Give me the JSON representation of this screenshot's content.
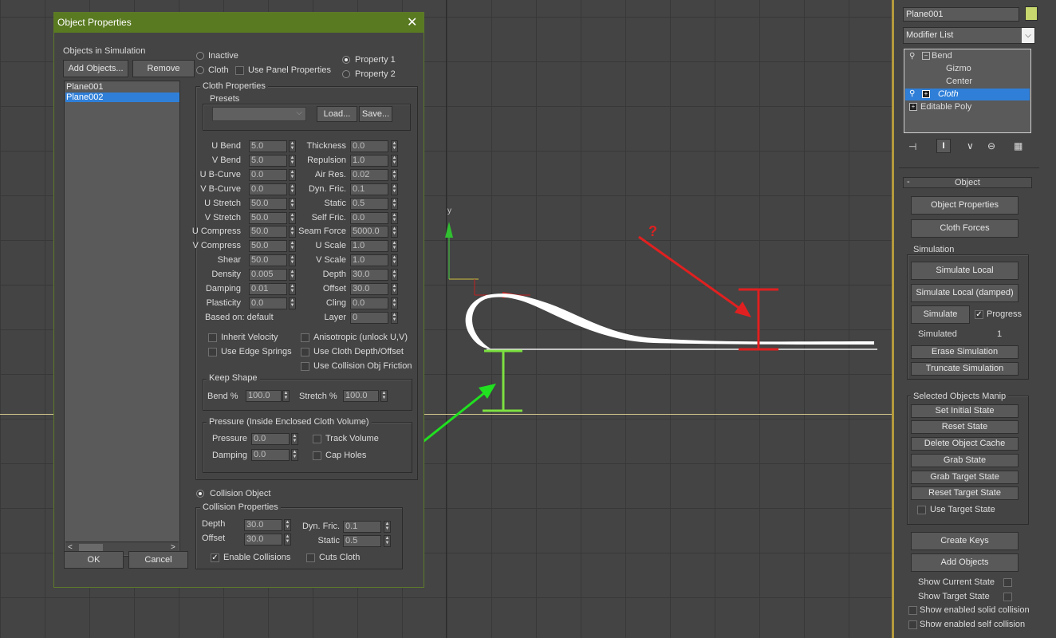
{
  "dialog": {
    "title": "Object Properties",
    "objects_label": "Objects in Simulation",
    "add_objects": "Add Objects...",
    "remove": "Remove",
    "objects": [
      "Plane001",
      "Plane002"
    ],
    "selected_object": "Plane002",
    "ok": "OK",
    "cancel": "Cancel",
    "inactive": "Inactive",
    "cloth": "Cloth",
    "use_panel_properties": "Use Panel Properties",
    "property1": "Property 1",
    "property2": "Property 2",
    "cloth_properties_title": "Cloth Properties",
    "presets_title": "Presets",
    "load": "Load...",
    "save": "Save...",
    "left_params": [
      {
        "label": "U Bend",
        "value": "5.0"
      },
      {
        "label": "V Bend",
        "value": "5.0"
      },
      {
        "label": "U B-Curve",
        "value": "0.0"
      },
      {
        "label": "V B-Curve",
        "value": "0.0"
      },
      {
        "label": "U Stretch",
        "value": "50.0"
      },
      {
        "label": "V Stretch",
        "value": "50.0"
      },
      {
        "label": "U Compress",
        "value": "50.0"
      },
      {
        "label": "V Compress",
        "value": "50.0"
      },
      {
        "label": "Shear",
        "value": "50.0"
      },
      {
        "label": "Density",
        "value": "0.005"
      },
      {
        "label": "Damping",
        "value": "0.01"
      },
      {
        "label": "Plasticity",
        "value": "0.0"
      }
    ],
    "right_params": [
      {
        "label": "Thickness",
        "value": "0.0"
      },
      {
        "label": "Repulsion",
        "value": "1.0"
      },
      {
        "label": "Air Res.",
        "value": "0.02"
      },
      {
        "label": "Dyn. Fric.",
        "value": "0.1"
      },
      {
        "label": "Static",
        "value": "0.5"
      },
      {
        "label": "Self Fric.",
        "value": "0.0"
      },
      {
        "label": "Seam Force",
        "value": "5000.0"
      },
      {
        "label": "U Scale",
        "value": "1.0"
      },
      {
        "label": "V Scale",
        "value": "1.0"
      },
      {
        "label": "Depth",
        "value": "30.0"
      },
      {
        "label": "Offset",
        "value": "30.0"
      },
      {
        "label": "Cling",
        "value": "0.0"
      },
      {
        "label": "Layer",
        "value": "0"
      }
    ],
    "based_on": "Based on: default",
    "inherit_velocity": "Inherit Velocity",
    "use_edge_springs": "Use Edge Springs",
    "anisotropic": "Anisotropic (unlock U,V)",
    "use_cloth_depth": "Use Cloth Depth/Offset",
    "use_collision_friction": "Use Collision Obj Friction",
    "keep_shape_title": "Keep Shape",
    "bend_pct_label": "Bend %",
    "bend_pct": "100.0",
    "stretch_pct_label": "Stretch %",
    "stretch_pct": "100.0",
    "pressure_title": "Pressure (Inside Enclosed Cloth Volume)",
    "pressure_label": "Pressure",
    "pressure": "0.0",
    "damping_label": "Damping",
    "pressure_damping": "0.0",
    "track_volume": "Track Volume",
    "cap_holes": "Cap Holes",
    "collision_object": "Collision Object",
    "collision_properties_title": "Collision Properties",
    "col_depth_label": "Depth",
    "col_depth": "30.0",
    "col_offset_label": "Offset",
    "col_offset": "30.0",
    "col_dynfric_label": "Dyn. Fric.",
    "col_dynfric": "0.1",
    "col_static_label": "Static",
    "col_static": "0.5",
    "enable_collisions": "Enable Collisions",
    "cuts_cloth": "Cuts Cloth"
  },
  "viewport": {
    "axis_y": "y",
    "question": "?"
  },
  "panel": {
    "object_name": "Plane001",
    "object_color": "#c8d86e",
    "modifier_list": "Modifier List",
    "stack": [
      {
        "label": "Bend",
        "indent": 0
      },
      {
        "label": "Gizmo",
        "indent": 1
      },
      {
        "label": "Center",
        "indent": 1
      },
      {
        "label": "Cloth",
        "indent": 0,
        "selected": true
      },
      {
        "label": "Editable Poly",
        "indent": 0
      }
    ],
    "rollout_title": "Object",
    "object_properties": "Object Properties",
    "cloth_forces": "Cloth Forces",
    "simulation_title": "Simulation",
    "simulate_local": "Simulate Local",
    "simulate_local_damped": "Simulate Local (damped)",
    "simulate": "Simulate",
    "progress": "Progress",
    "simulated_label": "Simulated",
    "simulated_value": "1",
    "erase_simulation": "Erase Simulation",
    "truncate_simulation": "Truncate Simulation",
    "manip_title": "Selected Objects Manip",
    "set_initial_state": "Set Initial State",
    "reset_state": "Reset State",
    "delete_object_cache": "Delete Object Cache",
    "grab_state": "Grab State",
    "grab_target_state": "Grab Target State",
    "reset_target_state": "Reset Target State",
    "use_target_state": "Use Target State",
    "create_keys": "Create Keys",
    "add_objects": "Add Objects",
    "show_current_state": "Show Current State",
    "show_target_state": "Show Target State",
    "show_solid_collision": "Show enabled solid collision",
    "show_self_collision": "Show enabled self collision"
  },
  "colors": {
    "title_bar": "#5a7a22",
    "selection": "#2f7fd8",
    "red_annotation": "#e02020",
    "green_annotation": "#20e020"
  }
}
